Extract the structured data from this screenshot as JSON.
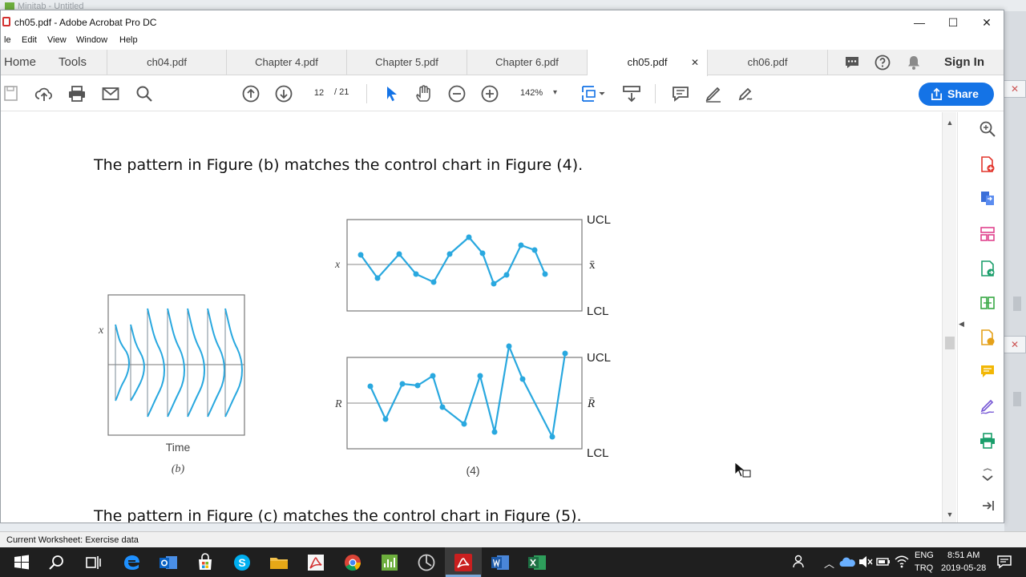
{
  "background_app": {
    "title": "Minitab - Untitled"
  },
  "window": {
    "title": "ch05.pdf - Adobe Acrobat Pro DC",
    "minimize": "—",
    "maximize": "☐",
    "close": "✕"
  },
  "menu": [
    "le",
    "Edit",
    "View",
    "Window",
    "Help"
  ],
  "nav": {
    "home": "Home",
    "tools": "Tools"
  },
  "tabs": [
    {
      "label": "ch04.pdf"
    },
    {
      "label": "Chapter 4.pdf"
    },
    {
      "label": "Chapter 5.pdf"
    },
    {
      "label": "Chapter 6.pdf"
    },
    {
      "label": "ch05.pdf",
      "close": "✕"
    },
    {
      "label": "ch06.pdf"
    }
  ],
  "signin": "Sign In",
  "toolbar": {
    "page_current": "12",
    "page_total": "/ 21",
    "zoom": "142%",
    "share": "Share"
  },
  "document": {
    "line1": "The pattern in Figure (b) matches the control chart in Figure (4).",
    "line2": "The pattern in Figure (c) matches the control chart in Figure (5).",
    "fig_b": {
      "ylabel": "x",
      "xlabel": "Time",
      "caption": "(b)"
    },
    "fig_4": {
      "caption": "(4)",
      "xbar_chart": {
        "ylabel": "x",
        "ucl": "UCL",
        "center": "x̄",
        "lcl": "LCL"
      },
      "r_chart": {
        "ylabel": "R",
        "ucl": "UCL",
        "center": "R̄",
        "lcl": "LCL"
      }
    }
  },
  "status": {
    "text": "Current Worksheet: Exercise data"
  },
  "taskbar": {
    "lang1": "ENG",
    "lang2": "TRQ",
    "time": "8:51 AM",
    "date": "2019-05-28"
  },
  "colors": {
    "accent": "#1473e6",
    "chart_line": "#29a8df",
    "acrobat_red": "#d32f2f"
  }
}
